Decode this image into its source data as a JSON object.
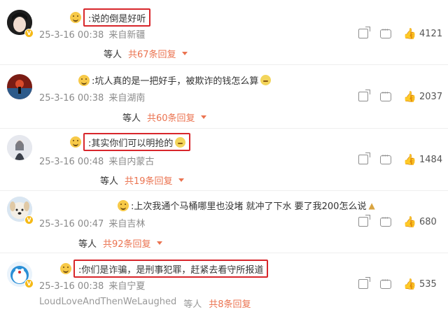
{
  "comments": [
    {
      "text": ":说的倒是好听",
      "time": "25-3-16 00:38",
      "location": "来自新疆",
      "likes": "4121",
      "reply_prefix": "等人",
      "reply_count": "共67条回复"
    },
    {
      "text": ":坑人真的是一把好手，被欺诈的钱怎么算",
      "time": "25-3-16 00:38",
      "location": "来自湖南",
      "likes": "2037",
      "reply_prefix": "等人",
      "reply_count": "共60条回复"
    },
    {
      "text": ":其实你们可以明抢的",
      "time": "25-3-16 00:48",
      "location": "来自内蒙古",
      "likes": "1484",
      "reply_prefix": "等人",
      "reply_count": "共19条回复"
    },
    {
      "text": ":上次我通个马桶哪里也没堵 就冲了下水 要了我200怎么说",
      "time": "25-3-16 00:47",
      "location": "来自吉林",
      "likes": "680",
      "reply_prefix": "等人",
      "reply_count": "共92条回复"
    },
    {
      "text": ":你们是诈骗，是刑事犯罪，赶紧去看守所报道",
      "time": "25-3-16 00:38",
      "location": "来自宁夏",
      "likes": "535",
      "reply_prefix": "等人",
      "reply_count": "共8条回复"
    }
  ],
  "cut_off": {
    "user": "LoudLoveAndThenWeLaughed",
    "who": "等人",
    "count": "共8条回复"
  },
  "colors": {
    "highlight": "#d8262b",
    "reply_accent": "#eb7350",
    "meta": "#8b8b8b",
    "badge": "#f5b916"
  },
  "icons": {
    "share": "share-icon",
    "comment": "comment-icon",
    "like": "thumbs-up-icon"
  }
}
